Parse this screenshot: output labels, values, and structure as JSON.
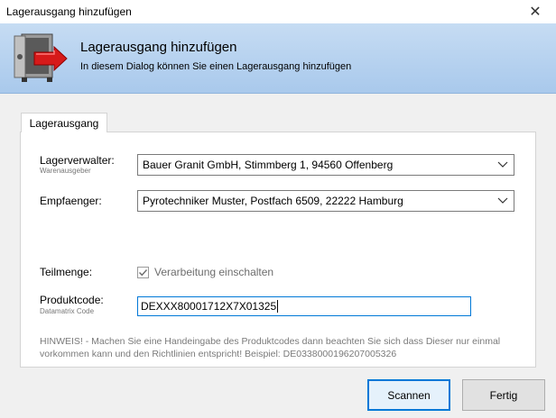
{
  "window": {
    "title": "Lagerausgang hinzufügen",
    "close_glyph": "✕"
  },
  "header": {
    "title": "Lagerausgang hinzufügen",
    "subtitle": "In diesem Dialog können Sie einen Lagerausgang hinzufügen",
    "icon": "safe-icon"
  },
  "tab": {
    "label": "Lagerausgang"
  },
  "form": {
    "lagerverwalter": {
      "label": "Lagerverwalter:",
      "sublabel": "Warenausgeber",
      "value": "Bauer Granit GmbH, Stimmberg 1, 94560 Offenberg"
    },
    "empfaenger": {
      "label": "Empfaenger:",
      "value": "Pyrotechniker Muster, Postfach 6509, 22222 Hamburg"
    },
    "teilmenge": {
      "label": "Teilmenge:",
      "checkbox_label": "Verarbeitung einschalten",
      "checked": true
    },
    "produktcode": {
      "label": "Produktcode:",
      "sublabel": "Datamatrix Code",
      "value": "DEXXX80001712X7X01325"
    },
    "hint_line1": "HINWEIS! - Machen Sie eine Handeingabe des Produktcodes dann beachten Sie sich dass Dieser nur einmal",
    "hint_line2": "vorkommen kann und den Richtlinien entspricht! Beispiel: DE0338000196207005326"
  },
  "buttons": {
    "scan": "Scannen",
    "done": "Fertig"
  },
  "colors": {
    "header_gradient_top": "#c6dcf3",
    "header_gradient_bottom": "#a9c9ec",
    "focus_accent": "#0078d7"
  }
}
